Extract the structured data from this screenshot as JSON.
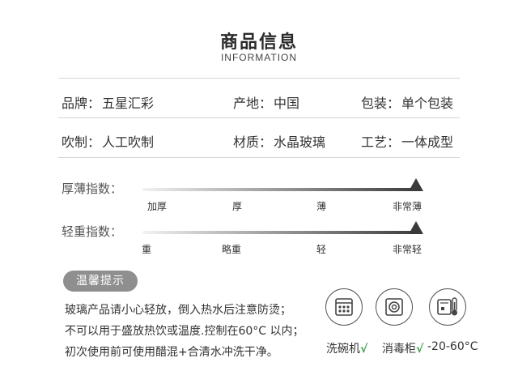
{
  "header": {
    "title": "商品信息",
    "subtitle": "INFORMATION"
  },
  "info": {
    "brand_label": "品牌：",
    "brand_value": "五星汇彩",
    "origin_label": "产地：",
    "origin_value": "中国",
    "package_label": "包装：",
    "package_value": "单个包装",
    "blowing_label": "吹制：",
    "blowing_value": "人工吹制",
    "material_label": "材质：",
    "material_value": "水晶玻璃",
    "craft_label": "工艺：",
    "craft_value": "一体成型"
  },
  "thickness": {
    "label": "厚薄指数：",
    "ticks": [
      "加厚",
      "厚",
      "薄",
      "非常薄"
    ],
    "selected": "非常薄"
  },
  "weight": {
    "label": "轻重指数：",
    "ticks": [
      "重",
      "略重",
      "轻",
      "非常轻"
    ],
    "selected": "非常轻"
  },
  "tips": {
    "badge": "温馨提示",
    "lines": [
      "玻璃产品请小心轻放，倒入热水后注意防烫；",
      "不可以用于盛放热饮或温度.控制在60°C 以内；",
      "初次使用前可使用醋混+合清水冲洗干净。"
    ]
  },
  "usage": {
    "dishwasher_label": "洗碗机",
    "dishwasher_check": "√",
    "sterilizer_label": "消毒柜",
    "sterilizer_check": "√",
    "temperature": "-20-60°C",
    "icons": [
      "dishwasher-icon",
      "sterilizer-icon",
      "thermometer-icon"
    ]
  },
  "colors": {
    "accent": "#3a3a3a",
    "badge": "#8f8f8f",
    "check": "#3ba04a"
  }
}
